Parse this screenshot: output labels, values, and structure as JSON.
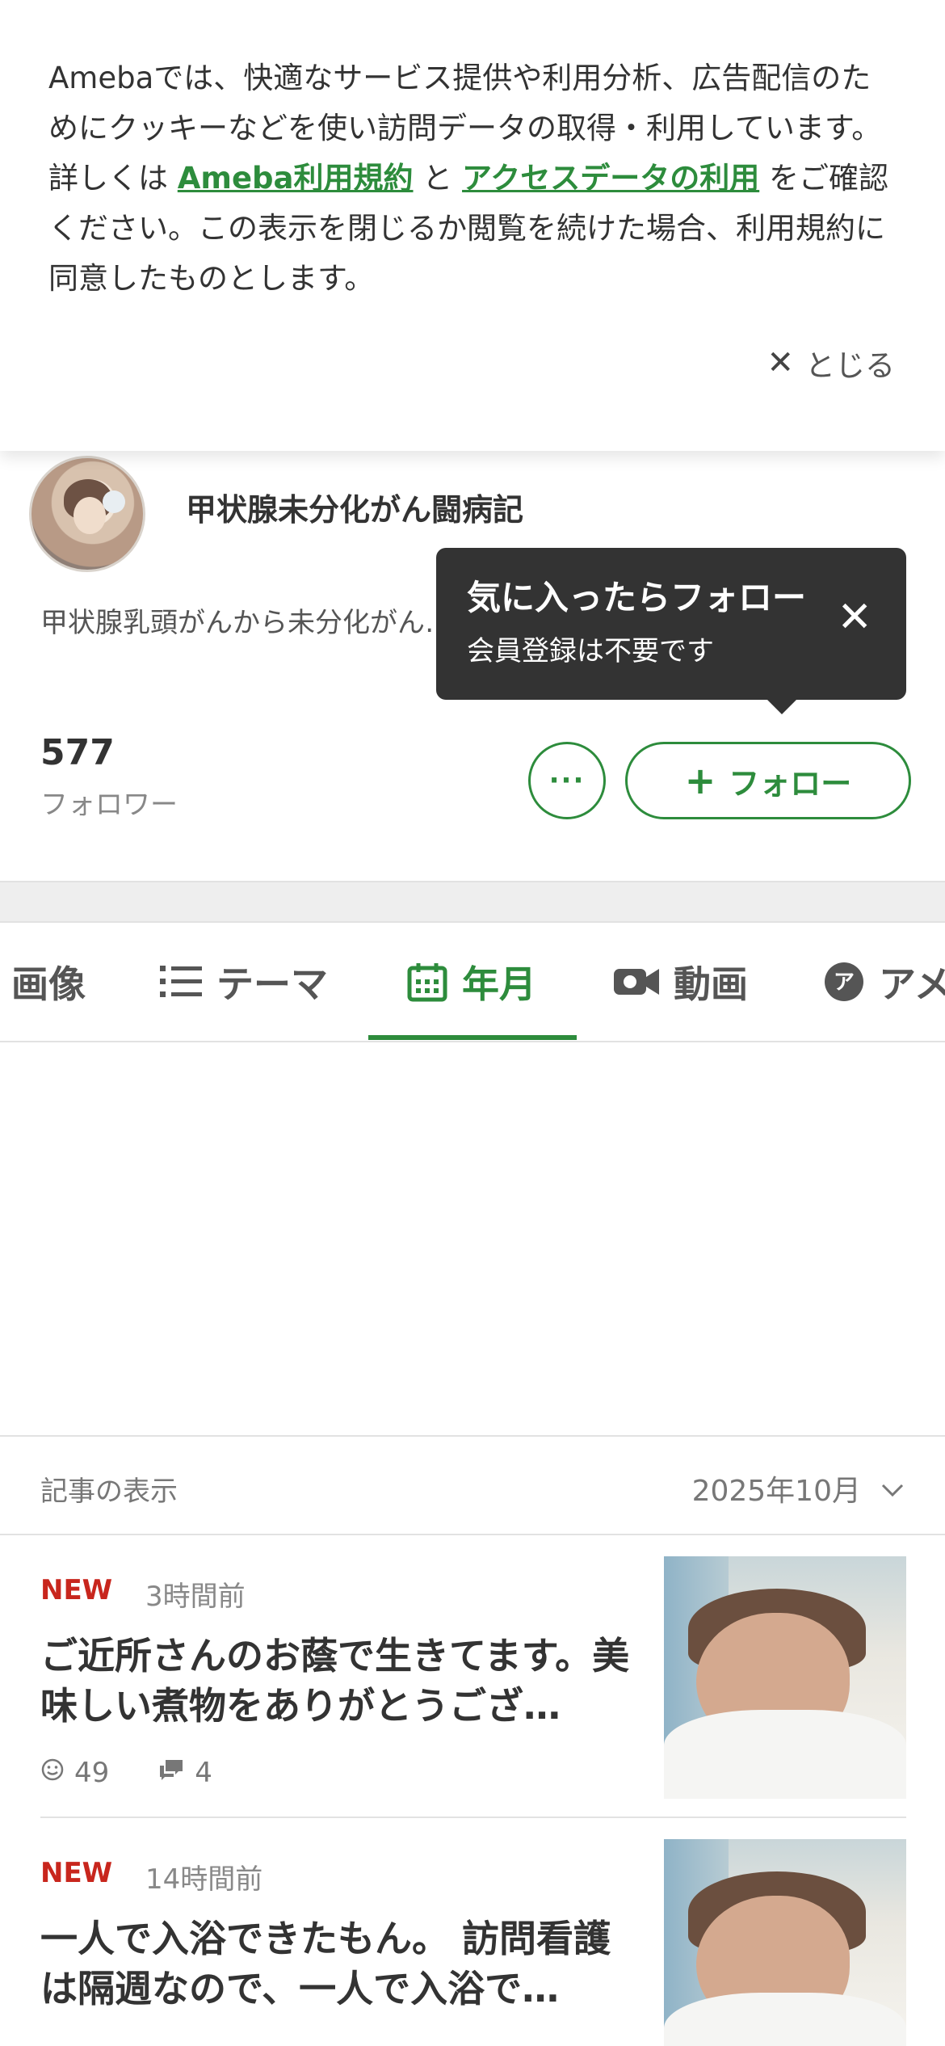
{
  "cookie_banner": {
    "text_part1": "Amebaでは、快適なサービス提供や利用分析、広告配信のためにクッキーなどを使い訪問データの取得・利用しています。詳しくは ",
    "link1": "Ameba利用規約",
    "text_part2": " と ",
    "link2": "アクセスデータの利用",
    "text_part3": " をご確認ください。この表示を閉じるか閲覧を続けた場合、利用規約に同意したものとします。",
    "close_label": "とじる"
  },
  "profile": {
    "blog_title": "甲状腺未分化がん闘病記",
    "description": "甲状腺乳頭がんから未分化がん…イバーのリアルながん情報を生…",
    "followers_count": "577",
    "followers_label": "フォロワー",
    "more_label": "···",
    "follow_label": "フォロー"
  },
  "tooltip": {
    "title": "気に入ったらフォロー",
    "subtitle": "会員登録は不要です"
  },
  "tabs": [
    {
      "label": "画像",
      "icon": "image-icon",
      "active": false
    },
    {
      "label": "テーマ",
      "icon": "list-icon",
      "active": false
    },
    {
      "label": "年月",
      "icon": "calendar-icon",
      "active": true
    },
    {
      "label": "動画",
      "icon": "video-icon",
      "active": false
    },
    {
      "label": "アメ",
      "icon": "ameba-icon",
      "active": false
    }
  ],
  "filter": {
    "label": "記事の表示",
    "value": "2025年10月"
  },
  "articles": [
    {
      "badge": "NEW",
      "time": "3時間前",
      "title": "ご近所さんのお蔭で生きてます。美味しい煮物をありがとうござ…",
      "likes": "49",
      "comments": "4"
    },
    {
      "badge": "NEW",
      "time": "14時間前",
      "title": "一人で入浴できたもん。 訪問看護は隔週なので、一人で入浴で…"
    }
  ],
  "colors": {
    "accent": "#2d8c3c",
    "new_badge": "#c8261d",
    "tooltip_bg": "#333333"
  }
}
